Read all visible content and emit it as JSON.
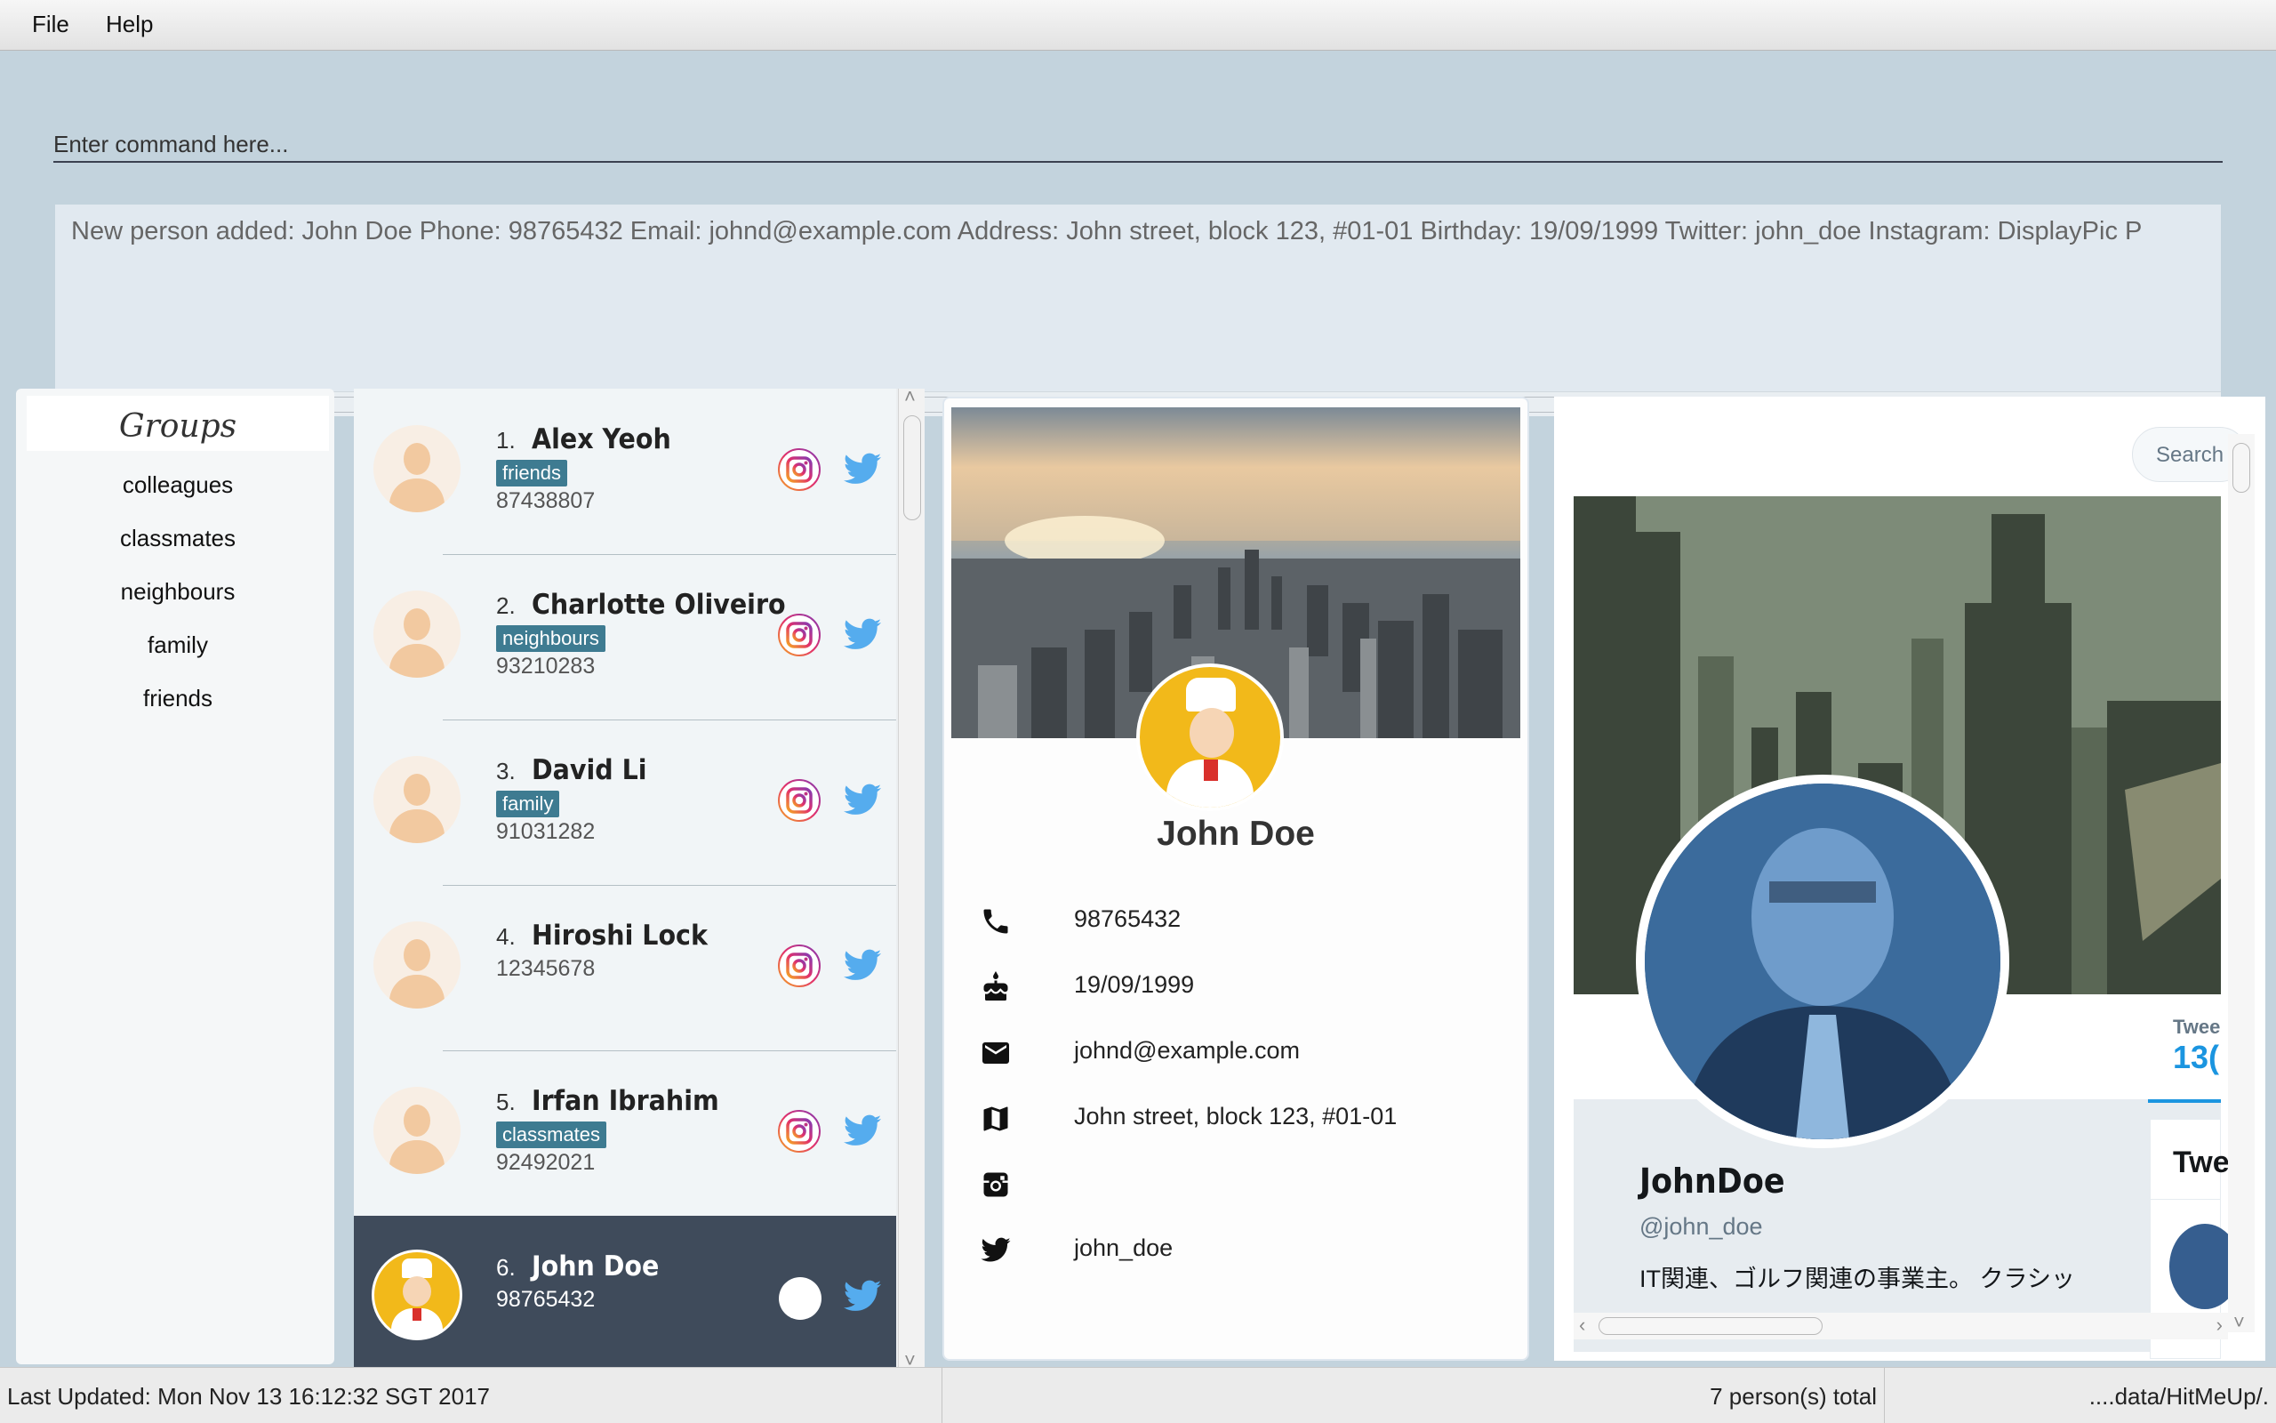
{
  "menu": {
    "file": "File",
    "help": "Help"
  },
  "command": {
    "placeholder": "Enter command here...",
    "result": "New person added: John Doe Phone: 98765432 Email: johnd@example.com Address: John street, block 123, #01-01 Birthday: 19/09/1999 Twitter: john_doe Instagram:  DisplayPic P"
  },
  "groups": {
    "title": "Groups",
    "items": [
      "colleagues",
      "classmates",
      "neighbours",
      "family",
      "friends"
    ]
  },
  "persons": [
    {
      "index": "1.",
      "name": "Alex Yeoh",
      "tag": "friends",
      "phone": "87438807",
      "icons": [
        "instagram-icon",
        "twitter-icon"
      ]
    },
    {
      "index": "2.",
      "name": "Charlotte Oliveiro",
      "tag": "neighbours",
      "phone": "93210283",
      "icons": [
        "instagram-icon",
        "twitter-icon"
      ]
    },
    {
      "index": "3.",
      "name": "David Li",
      "tag": "family",
      "phone": "91031282",
      "icons": [
        "instagram-icon",
        "twitter-icon"
      ]
    },
    {
      "index": "4.",
      "name": "Hiroshi Lock",
      "tag": "",
      "phone": "12345678",
      "icons": [
        "instagram-icon",
        "twitter-icon"
      ]
    },
    {
      "index": "5.",
      "name": "Irfan Ibrahim",
      "tag": "classmates",
      "phone": "92492021",
      "icons": [
        "instagram-icon",
        "twitter-icon"
      ]
    },
    {
      "index": "6.",
      "name": "John Doe",
      "tag": "",
      "phone": "98765432",
      "selected": true,
      "icons": [
        "blank-circle",
        "twitter-icon"
      ]
    }
  ],
  "details": {
    "name": "John Doe",
    "phone": "98765432",
    "birthday": "19/09/1999",
    "email": "johnd@example.com",
    "address": "John street, block 123, #01-01",
    "instagram": "",
    "twitter": "john_doe"
  },
  "browser": {
    "search_placeholder": "Search",
    "profile_name": "JohnDoe",
    "handle": "@john_doe",
    "bio": "IT関連、ゴルフ関連の事業主。 クラシッ",
    "tweets_label": "Twee",
    "tweets_count": "13(",
    "side_title": "Twe"
  },
  "status": {
    "last_updated": "Last Updated: Mon Nov 13 16:12:32 SGT 2017",
    "total": "7 person(s) total",
    "path": "....data/HitMeUp/."
  },
  "colors": {
    "accent_twitter": "#55acee",
    "tag_bg": "#3e7b91",
    "selected_card": "#3f4b5b",
    "command_bg": "#c3d3dd"
  }
}
